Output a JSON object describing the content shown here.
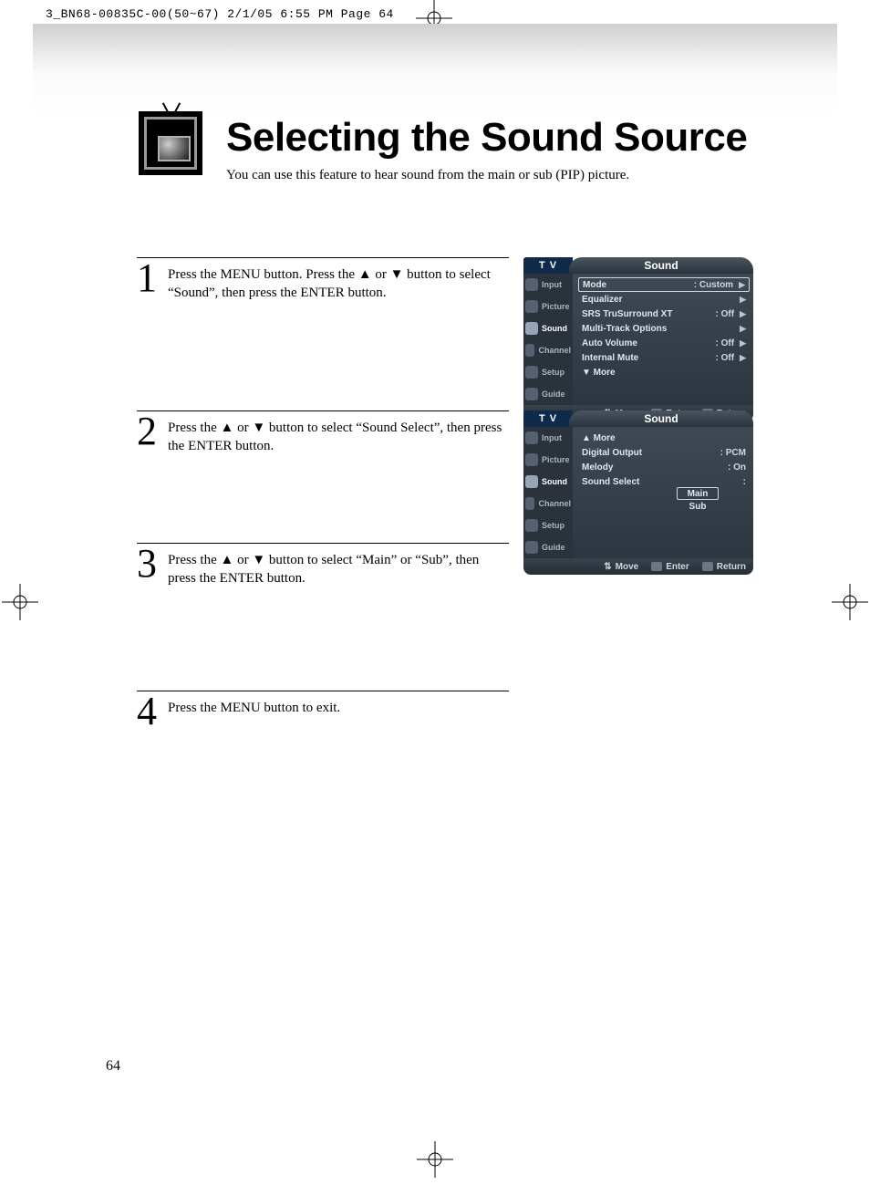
{
  "slug_line": "3_BN68-00835C-00(50~67)  2/1/05  6:55 PM  Page 64",
  "title": "Selecting the Sound Source",
  "subtitle": "You can use this feature to hear sound from the main or sub (PIP) picture.",
  "steps": [
    {
      "num": "1",
      "text": "Press the MENU button. Press the ▲ or ▼ button to select “Sound”, then press the ENTER button."
    },
    {
      "num": "2",
      "text": "Press the ▲ or ▼ button to select “Sound Select”, then press the ENTER button."
    },
    {
      "num": "3",
      "text": "Press the ▲ or ▼ button to select “Main” or “Sub”, then press the ENTER button."
    },
    {
      "num": "4",
      "text": "Press the MENU button to exit."
    }
  ],
  "page_number": "64",
  "osd_shared": {
    "tv_label_html": "T V",
    "leftnav": [
      {
        "label": "Input"
      },
      {
        "label": "Picture"
      },
      {
        "label": "Sound"
      },
      {
        "label": "Channel"
      },
      {
        "label": "Setup"
      },
      {
        "label": "Guide"
      }
    ],
    "hints": {
      "move": "Move",
      "enter": "Enter",
      "return": "Return"
    }
  },
  "osd1": {
    "title": "Sound",
    "items": [
      {
        "name": "Mode",
        "value": ": Custom",
        "arrow": true,
        "selected": true
      },
      {
        "name": "Equalizer",
        "value": "",
        "arrow": true
      },
      {
        "name": "SRS TruSurround XT",
        "value": ": Off",
        "arrow": true
      },
      {
        "name": "Multi-Track Options",
        "value": "",
        "arrow": true
      },
      {
        "name": "Auto Volume",
        "value": ": Off",
        "arrow": true
      },
      {
        "name": "Internal Mute",
        "value": ": Off",
        "arrow": true
      },
      {
        "name": "▼ More",
        "value": "",
        "arrow": false
      }
    ]
  },
  "osd2": {
    "title": "Sound",
    "items": [
      {
        "name": "▲ More",
        "value": "",
        "arrow": false
      },
      {
        "name": "Digital Output",
        "value": ": PCM",
        "arrow": false
      },
      {
        "name": "Melody",
        "value": ": On",
        "arrow": false
      },
      {
        "name": "Sound Select",
        "value": ":",
        "arrow": false
      }
    ],
    "submenu": {
      "selected": "Main",
      "other": "Sub"
    }
  }
}
